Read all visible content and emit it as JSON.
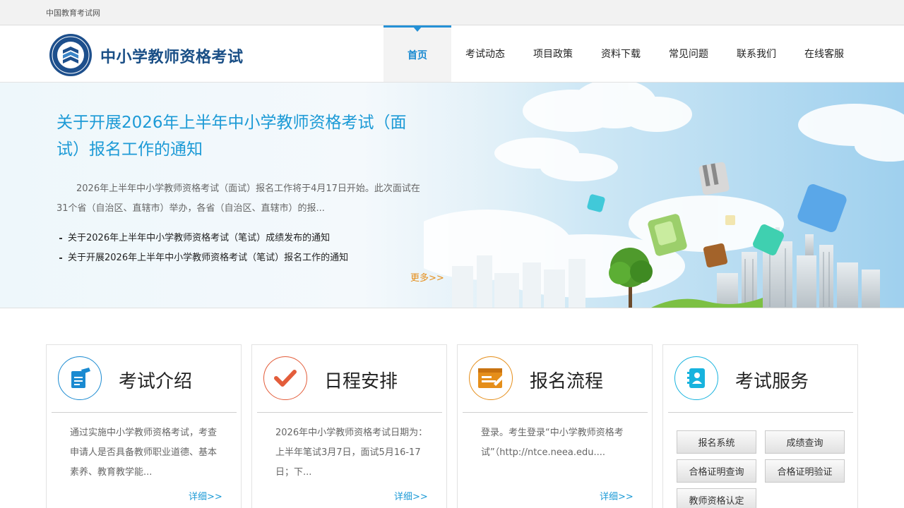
{
  "topbar": {
    "site_link": "中国教育考试网"
  },
  "header": {
    "logo_title": "中小学教师资格考试"
  },
  "nav": {
    "items": [
      {
        "label": "首页",
        "active": true
      },
      {
        "label": "考试动态"
      },
      {
        "label": "项目政策"
      },
      {
        "label": "资料下载"
      },
      {
        "label": "常见问题"
      },
      {
        "label": "联系我们"
      },
      {
        "label": "在线客服"
      }
    ]
  },
  "banner": {
    "title": "关于开展2026年上半年中小学教师资格考试（面试）报名工作的通知",
    "summary": "2026年上半年中小学教师资格考试（面试）报名工作将于4月17日开始。此次面试在31个省（自治区、直辖市）举办，各省（自治区、直辖市）的报...",
    "news": [
      "关于2026年上半年中小学教师资格考试（笔试）成绩发布的通知",
      "关于开展2026年上半年中小学教师资格考试（笔试）报名工作的通知"
    ],
    "more_label": "更多>>"
  },
  "cards": [
    {
      "title": "考试介绍",
      "icon": "edit-document-icon",
      "color": "#1a8ad1",
      "desc": "通过实施中小学教师资格考试，考查申请人是否具备教师职业道德、基本素养、教育教学能...",
      "more": "详细>>"
    },
    {
      "title": "日程安排",
      "icon": "checkmark-icon",
      "color": "#e35d3b",
      "desc": "2026年中小学教师资格考试日期为：上半年笔试3月7日，面试5月16-17日；下...",
      "more": "详细>>"
    },
    {
      "title": "报名流程",
      "icon": "form-flow-icon",
      "color": "#e58e1a",
      "desc": "登录。考生登录“中小学教师资格考试”（http://ntce.neea.edu....",
      "more": "详细>>"
    },
    {
      "title": "考试服务",
      "icon": "contact-book-icon",
      "color": "#17b3de",
      "services": [
        "报名系统",
        "成绩查询",
        "合格证明查询",
        "合格证明验证",
        "教师资格认定"
      ]
    }
  ]
}
